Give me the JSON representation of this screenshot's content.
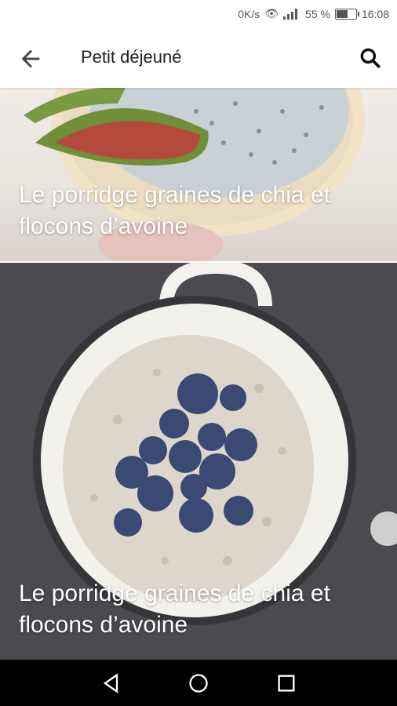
{
  "status": {
    "speed": "0K/s",
    "battery": "55 %",
    "time": "16:08",
    "battery_level": 0.55
  },
  "header": {
    "title": "Petit déjeuné",
    "back_icon": "arrow-left-icon",
    "search_icon": "search-icon"
  },
  "recipes": [
    {
      "title": "Le porridge graines de chia et flocons d’avoine"
    },
    {
      "title": "Le porridge graines de chia et flocons d’avoine"
    }
  ],
  "colors": {
    "appbar": "#ffffff",
    "navbar": "#000000",
    "card_text": "#ffffff",
    "blueberry": "#3b4a73"
  }
}
